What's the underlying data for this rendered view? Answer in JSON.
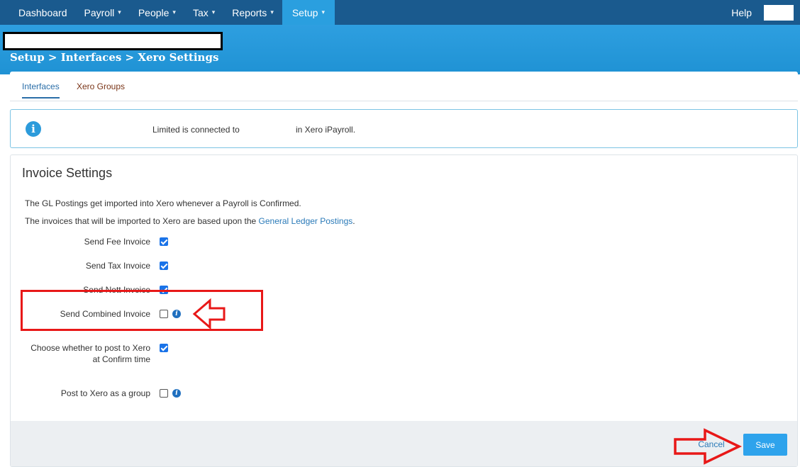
{
  "nav": {
    "items": [
      {
        "label": "Dashboard",
        "dropdown": false,
        "active": false
      },
      {
        "label": "Payroll",
        "dropdown": true,
        "active": false
      },
      {
        "label": "People",
        "dropdown": true,
        "active": false
      },
      {
        "label": "Tax",
        "dropdown": true,
        "active": false
      },
      {
        "label": "Reports",
        "dropdown": true,
        "active": false
      },
      {
        "label": "Setup",
        "dropdown": true,
        "active": true
      }
    ],
    "caret": "▾",
    "help": "Help"
  },
  "header": {
    "breadcrumb": "Setup > Interfaces > Xero Settings"
  },
  "tabs": [
    {
      "label": "Interfaces",
      "active": true
    },
    {
      "label": "Xero Groups",
      "active": false
    }
  ],
  "alert": {
    "icon": "info-icon",
    "text_part1": "Limited is connected to",
    "text_part2": "in Xero iPayroll."
  },
  "invoice_settings": {
    "title": "Invoice Settings",
    "line1": "The GL Postings get imported into Xero whenever a Payroll is Confirmed.",
    "line2_prefix": "The invoices that will be imported to Xero are based upon the ",
    "line2_link": "General Ledger Postings",
    "line2_suffix": ".",
    "options": [
      {
        "label": "Send Fee Invoice",
        "checked": true,
        "info": false
      },
      {
        "label": "Send Tax Invoice",
        "checked": true,
        "info": false
      },
      {
        "label": "Send Nett Invoice",
        "checked": true,
        "info": false
      },
      {
        "label": "Send Combined Invoice",
        "checked": false,
        "info": true
      },
      {
        "label_line1": "Choose whether to post to Xero",
        "label_line2": "at Confirm time",
        "checked": true,
        "info": false
      },
      {
        "label": "Post to Xero as a group",
        "checked": false,
        "info": true
      }
    ],
    "info_glyph": "i"
  },
  "footer": {
    "cancel": "Cancel",
    "save": "Save"
  },
  "colors": {
    "nav_bg": "#1a5a8e",
    "nav_active": "#2a9fdf",
    "header_band": "#2a9ade",
    "checkbox_checked": "#1a73e8",
    "save_button": "#2ea3ec",
    "annotation_red": "#e81818"
  }
}
